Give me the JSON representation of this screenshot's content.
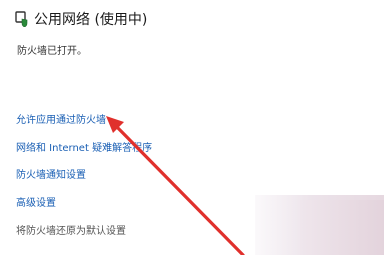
{
  "header": {
    "icon": "network-shield-icon",
    "title": "公用网络 (使用中)"
  },
  "status": "防火墙已打开。",
  "links": [
    {
      "label": "允许应用通过防火墙"
    },
    {
      "label": "网络和 Internet 疑难解答程序"
    },
    {
      "label": "防火墙通知设置"
    },
    {
      "label": "高级设置"
    },
    {
      "label": "将防火墙还原为默认设置"
    }
  ],
  "colors": {
    "link": "#1a5fb4",
    "arrow": "#e0302c"
  }
}
